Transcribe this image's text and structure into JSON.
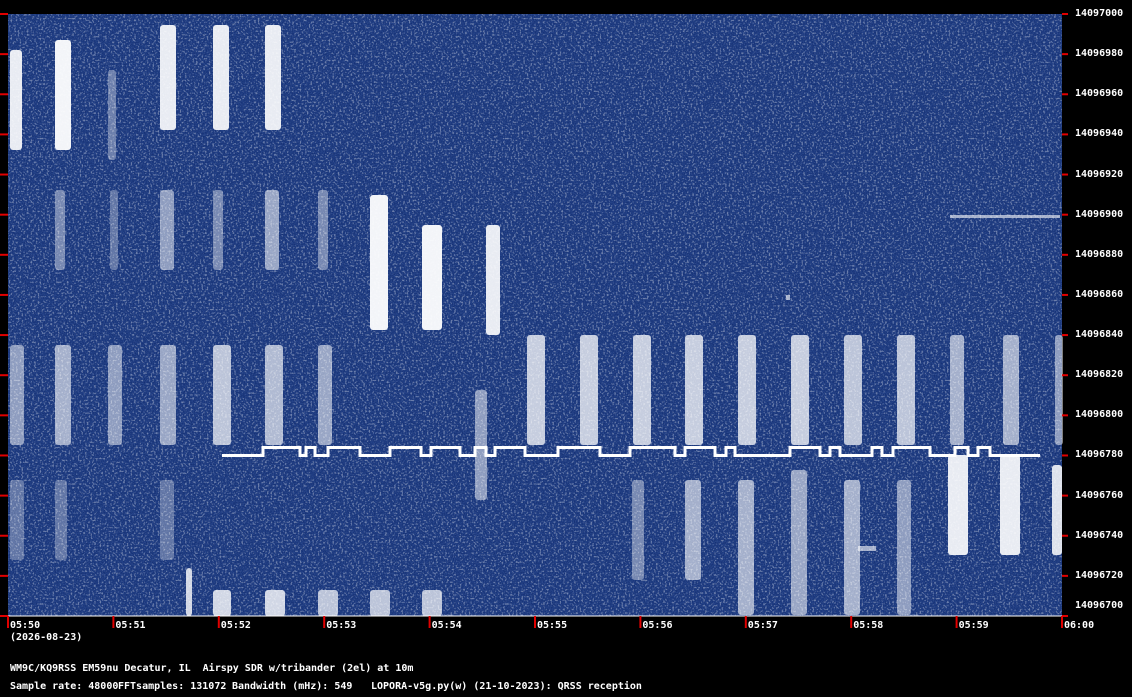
{
  "chart_data": {
    "type": "heatmap",
    "title": "",
    "xlabel": "",
    "ylabel": "",
    "x_ticks": [
      "05:50",
      "05:51",
      "05:52",
      "05:53",
      "05:54",
      "05:55",
      "05:56",
      "05:57",
      "05:58",
      "05:59",
      "06:00"
    ],
    "x_date": "(2026-08-23)",
    "y_ticks": [
      14097000,
      14096980,
      14096960,
      14096940,
      14096920,
      14096900,
      14096880,
      14096860,
      14096840,
      14096820,
      14096800,
      14096780,
      14096760,
      14096740,
      14096720,
      14096700
    ],
    "ylim": [
      14096700,
      14097000
    ],
    "colors": {
      "background": "#0d2a6b",
      "signal": "#ffffff",
      "tick": "#e00000"
    }
  },
  "footer": {
    "station_line": "WM9C/KQ9RSS EM59nu Decatur, IL  Airspy SDR w/tribander (2el) at 10m",
    "sample_rate": "Sample rate: 48000",
    "fft_samples": "FFTsamples: 131072",
    "bandwidth": "Bandwidth (mHz): 549",
    "software": "LOPORA-v5g.py(w) (21-10-2023): QRSS reception"
  }
}
